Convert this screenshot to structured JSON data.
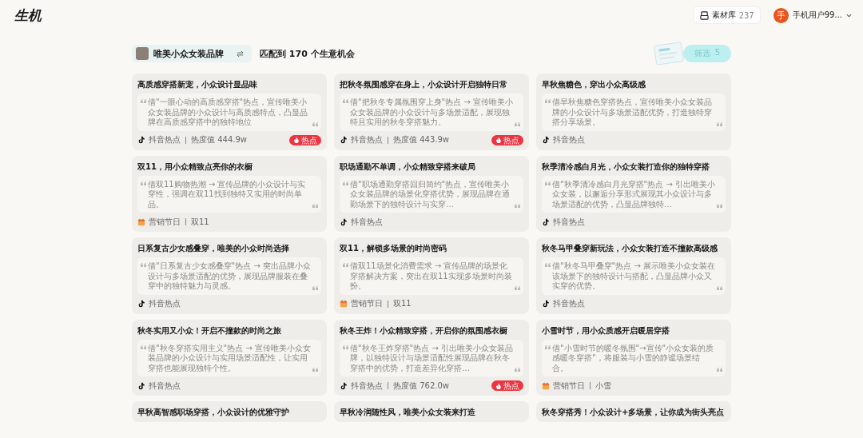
{
  "header": {
    "logo": "生机",
    "library": {
      "label": "素材库",
      "count": "237"
    },
    "user": {
      "avatar": "手",
      "name": "手机用户99..."
    }
  },
  "toolbar": {
    "brand": "唯美小众女装品牌",
    "match_text": "匹配到 170 个生意机会",
    "filter": {
      "label": "筛选",
      "count": "5"
    }
  },
  "cards": [
    {
      "title": "高质感穿搭新宠，小众设计显品味",
      "desc": "借\"一眼心动的高质感穿搭\"热点，宣传唯美小众女装品牌的小众设计与高质感特点，凸显品牌在高质感穿搭中的独特地位",
      "source": {
        "kind": "douyin",
        "label": "抖音热点"
      },
      "extra": "热度值 444.9w",
      "hot": "热点"
    },
    {
      "title": "把秋冬氛围感穿在身上，小众设计开启独特日常",
      "desc": "借\"把秋冬专属氛围穿上身\"热点 → 宣传唯美小众女装品牌的小众设计与多场景适配，展现独特且实用的秋冬穿搭魅力。",
      "source": {
        "kind": "douyin",
        "label": "抖音热点"
      },
      "extra": "热度值 443.9w",
      "hot": "热点"
    },
    {
      "title": "早秋焦糖色，穿出小众高级感",
      "desc": "借早秋焦糖色穿搭热点，宣传唯美小众女装品牌的小众设计与多场景适配优势，打造独特穿搭分享场景。",
      "source": {
        "kind": "douyin",
        "label": "抖音热点"
      }
    },
    {
      "title": "双11，用小众精致点亮你的衣橱",
      "desc": "借双11购物热潮 → 宣传品牌的小众设计与实穿性，强调在双11找到独特又实用的时尚单品。",
      "source": {
        "kind": "festival",
        "label": "营销节日"
      },
      "extra": "双11"
    },
    {
      "title": "职场通勤不单调，小众精致穿搭来破局",
      "desc": "借\"职场通勤穿搭回归简约\"热点，宣传唯美小众女装品牌的场景化穿搭优势，展现品牌在通勤场景下的独特设计与实穿…",
      "source": {
        "kind": "douyin",
        "label": "抖音热点"
      }
    },
    {
      "title": "秋季清冷感白月光，小众女装打造你的独特穿搭",
      "desc": "借\"秋季清冷感白月光穿搭\"热点 → 引出唯美小众女装，以邂逅分享形式展现其小众设计与多场景适配的优势，凸显品牌独特…",
      "source": {
        "kind": "douyin",
        "label": "抖音热点"
      }
    },
    {
      "title": "日系复古少女感叠穿，唯美的小众时尚选择",
      "desc": "借\"日系复古少女感叠穿\"热点 → 突出品牌小众设计与多场景适配的优势，展现品牌服装在叠穿中的独特魅力与灵感。",
      "source": {
        "kind": "douyin",
        "label": "抖音热点"
      }
    },
    {
      "title": "双11，解锁多场景的时尚密码",
      "desc": "借双11场景化消费需求 → 宣传品牌的场景化穿搭解决方案，突出在双11实现多场景时尚装扮。",
      "source": {
        "kind": "festival",
        "label": "营销节日"
      },
      "extra": "双11"
    },
    {
      "title": "秋冬马甲叠穿新玩法，小众女装打造不撞款高级感",
      "desc": "借\"秋冬马甲叠穿\"热点 → 展示唯美小众女装在该场景下的独特设计与搭配，凸显品牌小众又实穿的优势。",
      "source": {
        "kind": "douyin",
        "label": "抖音热点"
      }
    },
    {
      "title": "秋冬实用又小众！开启不撞款的时尚之旅",
      "desc": "借\"秋冬穿搭实用主义\"热点 → 宣传唯美小众女装品牌的小众设计与实用场景适配性，让实用穿搭也能展现独特个性。",
      "source": {
        "kind": "douyin",
        "label": "抖音热点"
      }
    },
    {
      "title": "秋冬王炸！小众精致穿搭，开启你的氛围感衣橱",
      "desc": "借\"秋冬王炸穿搭\"热点 → 引出唯美小众女装品牌，以独特设计与场景适配性展现品牌在秋冬穿搭中的优势，打造差异化穿搭…",
      "source": {
        "kind": "douyin",
        "label": "抖音热点"
      },
      "extra": "热度值 762.0w",
      "hot": "热点"
    },
    {
      "title": "小雪时节，用小众质感开启暖居穿搭",
      "desc": "借\"小雪时节的暖冬氛围\"→宣传\"小众女装的质感暖冬穿搭\"，将服装与小雪的静谧场景结合。",
      "source": {
        "kind": "festival",
        "label": "营销节日"
      },
      "extra": "小雪"
    },
    {
      "title": "早秋高智感职场穿搭，小众设计的优雅守护"
    },
    {
      "title": "早秋冷润随性风，唯美小众女装来打造"
    },
    {
      "title": "秋冬穿搭秀！小众设计+多场景，让你成为街头亮点"
    }
  ]
}
